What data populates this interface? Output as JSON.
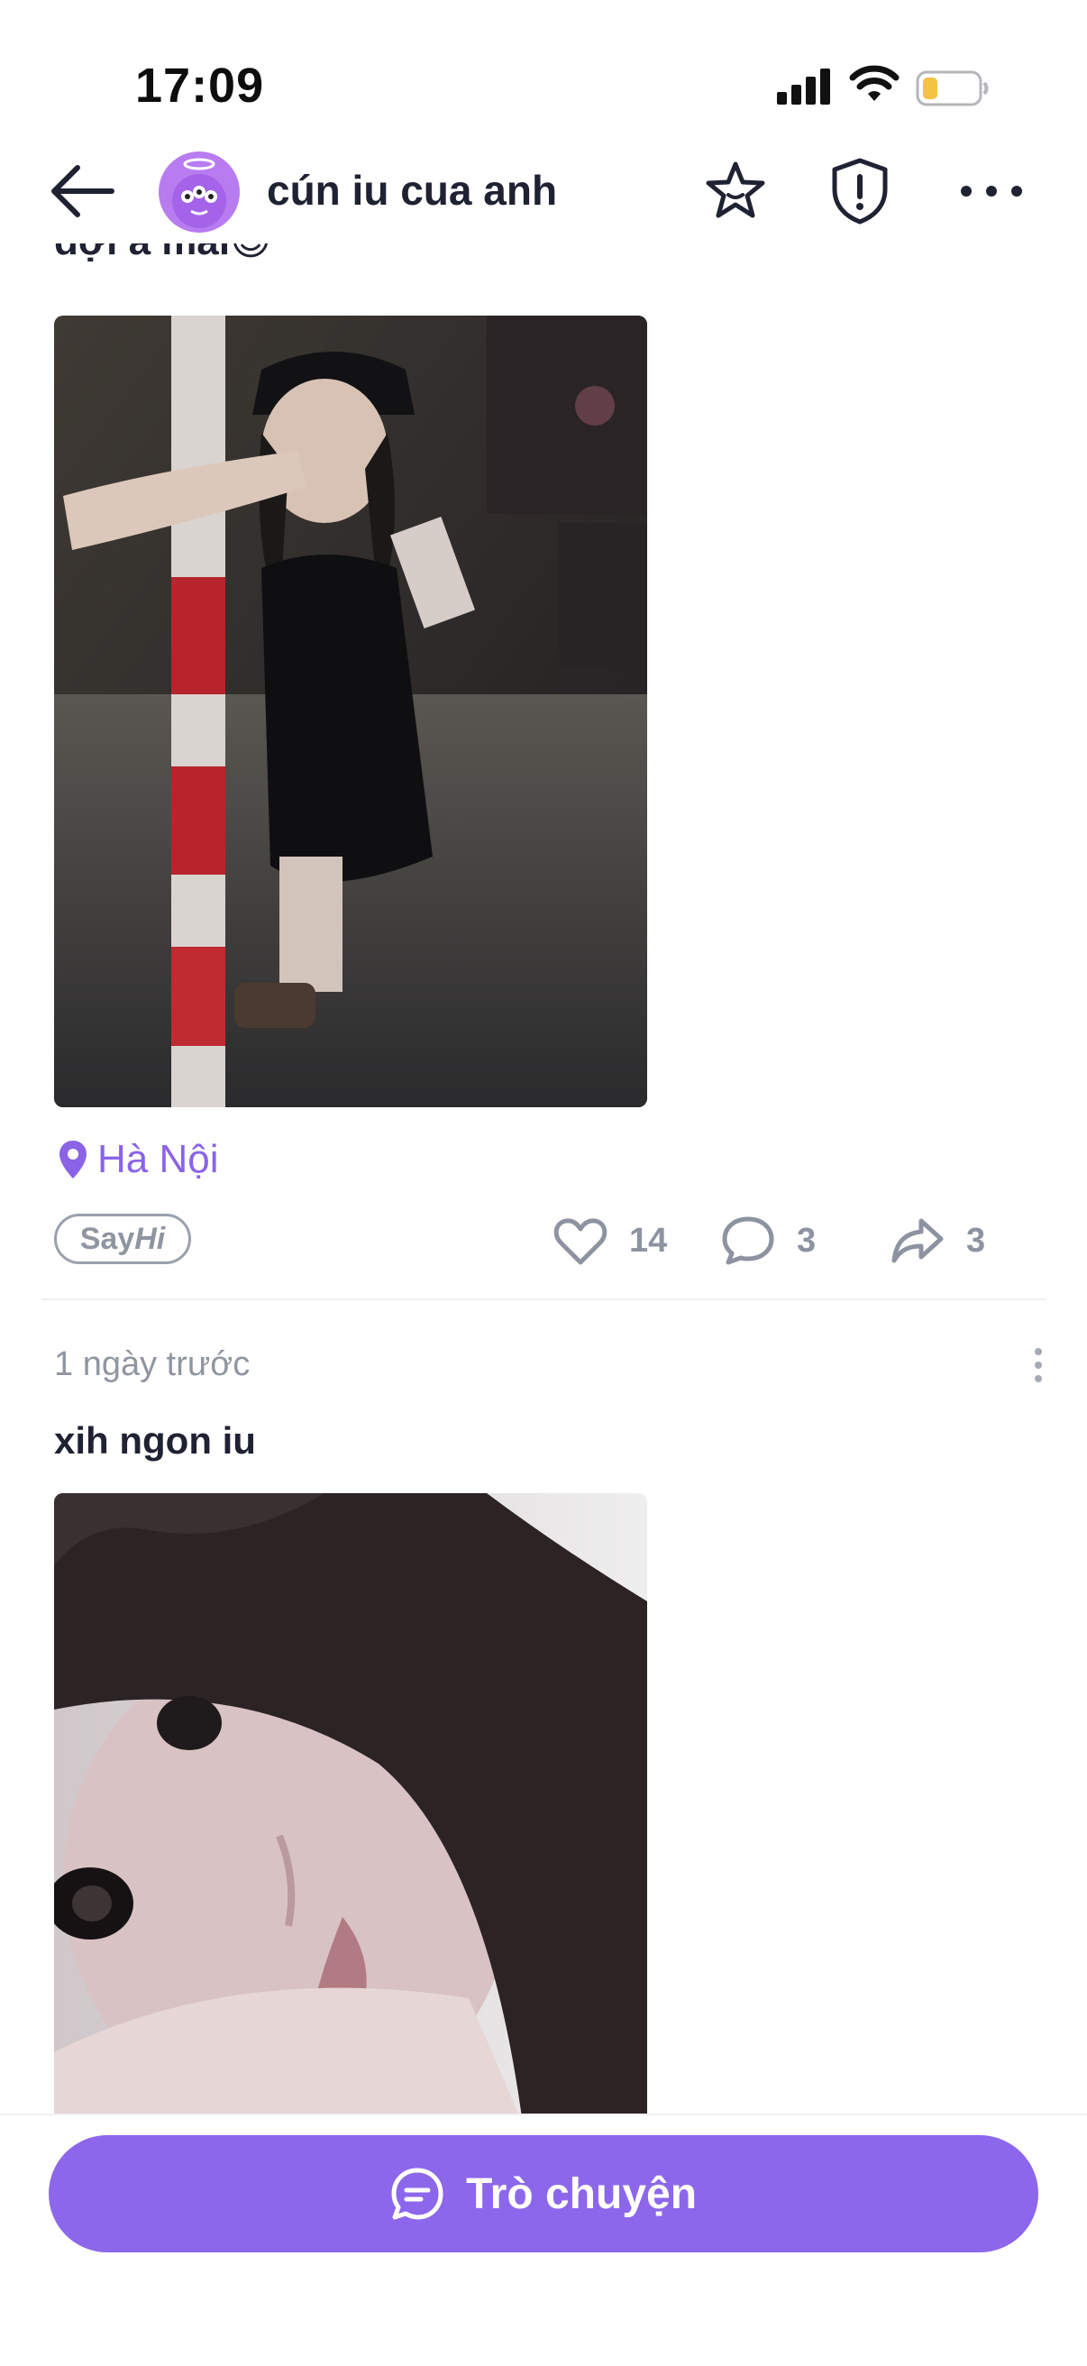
{
  "status_bar": {
    "time": "17:09",
    "icons": [
      "cellular-signal-icon",
      "wifi-icon",
      "battery-low-icon"
    ],
    "battery_color": "#f5c342"
  },
  "header": {
    "title": "cún iu cua anh",
    "icons": [
      "back-arrow-icon",
      "star-icon",
      "shield-alert-icon",
      "more-icon"
    ]
  },
  "posts": [
    {
      "caption": "đợi a mãi😊",
      "image": "night-street-photo",
      "location": "Hà Nội",
      "sayhi": {
        "say": "Say",
        "hi": "Hi"
      },
      "likes": "14",
      "comments": "3",
      "shares": "3"
    },
    {
      "time": "1 ngày trước",
      "caption": "xih ngon iu",
      "image": "selfie-close-up-photo"
    }
  ],
  "bottom": {
    "chat_label": "Trò chuyện",
    "accent": "#8c67ec"
  }
}
